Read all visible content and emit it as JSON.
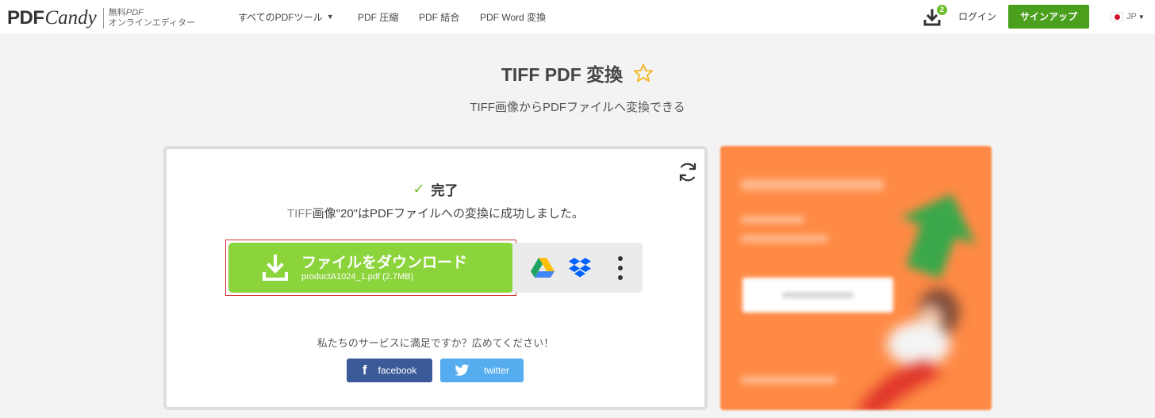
{
  "header": {
    "logo_pdf": "PDF",
    "logo_candy": "Candy",
    "logo_tag_line1_free": "無料",
    "logo_tag_line1_pdf": "PDF",
    "logo_tag_line2": "オンラインエディター",
    "nav": {
      "all_tools": "すべてのPDFツール",
      "compress": "PDF 圧縮",
      "merge": "PDF 結合",
      "word": "PDF Word 変換"
    },
    "downloads_badge": "2",
    "login": "ログイン",
    "signup": "サインアップ",
    "language": "JP"
  },
  "page": {
    "title": "TIFF PDF 変換",
    "subtitle": "TIFF画像からPDFファイルへ変換できる"
  },
  "result": {
    "status": "完了",
    "message_prefix": "TIFF",
    "message_body": "画像\"20\"はPDFファイルへの変換に成功しました。",
    "download_label": "ファイルをダウンロード",
    "download_file": "productA1024_1.pdf (2.7MB)"
  },
  "share": {
    "prompt": "私たちのサービスに満足ですか？広めてください！",
    "facebook": "facebook",
    "twitter": "twitter"
  },
  "colors": {
    "accent_green": "#8cd43c",
    "signup_green": "#4a9f1c",
    "facebook_blue": "#3b5a9a",
    "twitter_blue": "#55acee",
    "ad_orange": "#ff8a45"
  },
  "icons": [
    "download-tray-icon",
    "star-outline-icon",
    "refresh-icon",
    "check-icon",
    "google-drive-icon",
    "dropbox-icon",
    "more-vertical-icon",
    "facebook-icon",
    "twitter-icon"
  ]
}
